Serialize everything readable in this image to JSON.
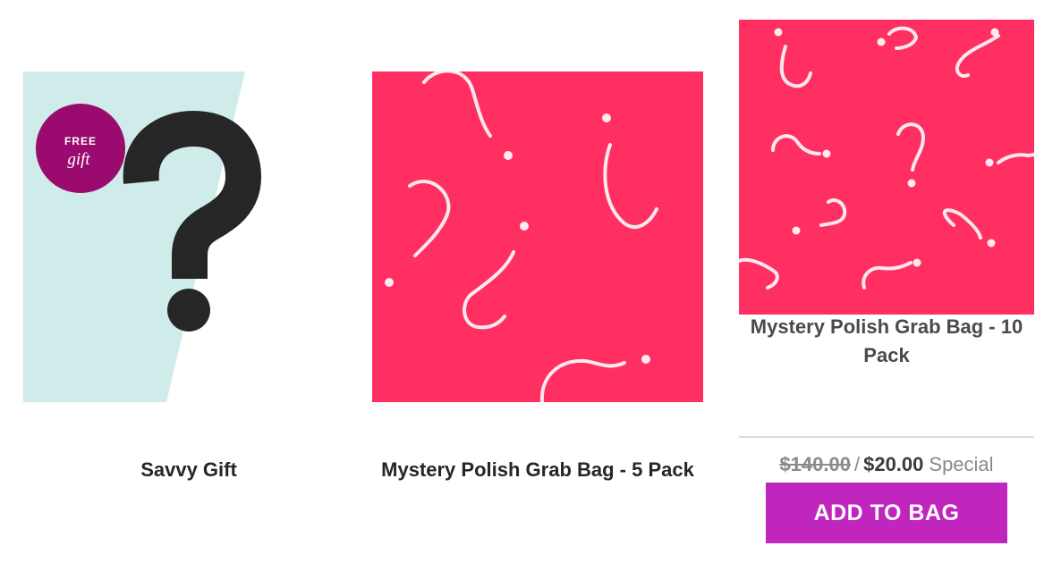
{
  "products": [
    {
      "title": "Savvy Gift",
      "badge": {
        "line1": "FREE",
        "line2": "gift"
      },
      "image_icon": "question-mark-icon"
    },
    {
      "title": "Mystery Polish Grab Bag - 5 Pack",
      "image_icon": "question-mark-pattern"
    },
    {
      "title": "Mystery Polish Grab Bag - 10 Pack",
      "image_icon": "question-mark-pattern",
      "old_price": "$140.00",
      "separator": "/",
      "new_price": "$20.00",
      "price_label": "Special",
      "button_label": "ADD TO BAG"
    }
  ],
  "colors": {
    "pattern_background": "#ff2f62",
    "pattern_stroke": "#ffe8ee",
    "savvy_background": "#cfeceb",
    "badge": "#9b0a6e",
    "button": "#c026bd"
  }
}
